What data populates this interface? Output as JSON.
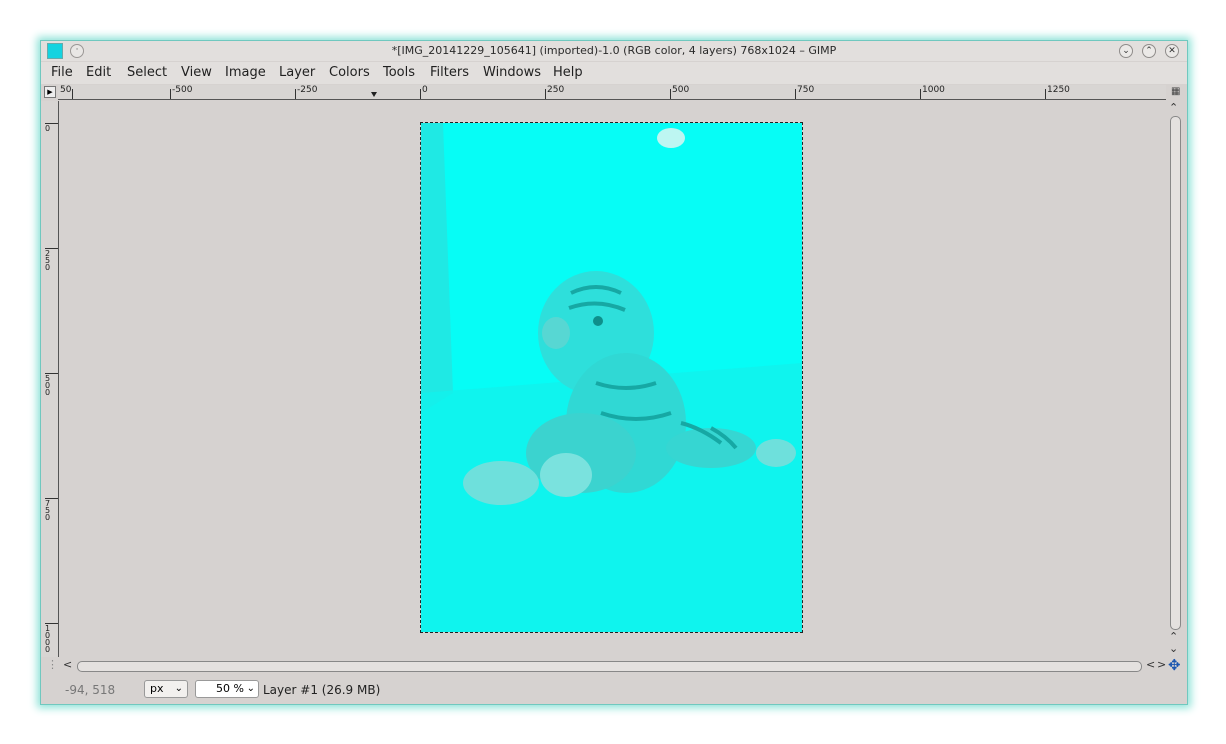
{
  "window": {
    "title": "*[IMG_20141229_105641] (imported)-1.0 (RGB color, 4 layers) 768x1024 – GIMP",
    "buttons": {
      "minimize": "⌄",
      "maximize": "⌃",
      "close": "✕"
    },
    "pin": "·"
  },
  "menu": [
    "File",
    "Edit",
    "Select",
    "View",
    "Image",
    "Layer",
    "Colors",
    "Tools",
    "Filters",
    "Windows",
    "Help"
  ],
  "ruler": {
    "horizontal_labels": [
      "50",
      "-500",
      "-250",
      "0",
      "250",
      "500",
      "750",
      "1000",
      "1250"
    ],
    "vertical_labels": [
      "0",
      "250",
      "500",
      "750",
      "1000"
    ]
  },
  "scroll_arrows": {
    "up": "⌃",
    "down": "⌄",
    "left": "<",
    "right": ">",
    "nav": "✥"
  },
  "status": {
    "coords": "-94, 518",
    "unit": "px",
    "zoom": "50 %",
    "layer_info": "Layer #1 (26.9 MB)"
  },
  "colors": {
    "image_tint": "#06fdf6",
    "glow": "#8fe3d8"
  }
}
